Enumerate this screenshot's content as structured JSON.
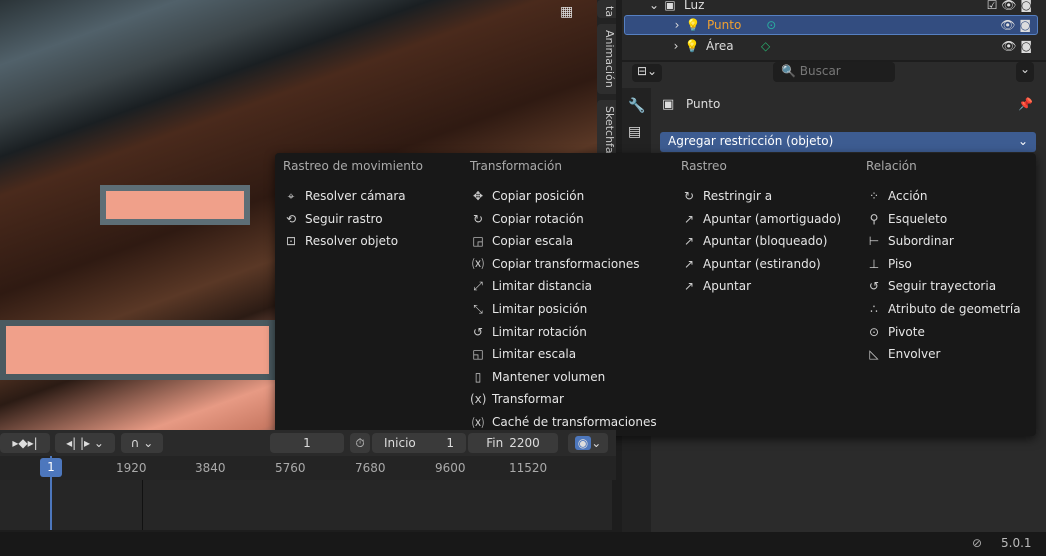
{
  "sidebar_tabs": [
    "ta",
    "Animación",
    "Sketchfa"
  ],
  "outliner": {
    "rows": [
      {
        "label": "Luz"
      },
      {
        "label": "Punto",
        "selected": true
      },
      {
        "label": "Área"
      }
    ]
  },
  "properties": {
    "search_placeholder": "Buscar",
    "object_name": "Punto",
    "add_constraint": "Agregar restricción (objeto)"
  },
  "menu": {
    "columns": [
      {
        "title": "Rastreo de movimiento",
        "items": [
          "Resolver cámara",
          "Seguir rastro",
          "Resolver objeto"
        ]
      },
      {
        "title": "Transformación",
        "items": [
          "Copiar posición",
          "Copiar rotación",
          "Copiar escala",
          "Copiar transformaciones",
          "Limitar distancia",
          "Limitar posición",
          "Limitar rotación",
          "Limitar escala",
          "Mantener volumen",
          "Transformar",
          "Caché de transformaciones"
        ]
      },
      {
        "title": "Rastreo",
        "items": [
          "Restringir a",
          "Apuntar (amortiguado)",
          "Apuntar (bloqueado)",
          "Apuntar (estirando)",
          "Apuntar"
        ]
      },
      {
        "title": "Relación",
        "items": [
          "Acción",
          "Esqueleto",
          "Subordinar",
          "Piso",
          "Seguir trayectoria",
          "Atributo de geometría",
          "Pivote",
          "Envolver"
        ]
      }
    ]
  },
  "timeline": {
    "current_frame": "1",
    "start_label": "Inicio",
    "start": "1",
    "end_label": "Fin",
    "end": "2200",
    "ticks": [
      "1920",
      "3840",
      "5760",
      "7680",
      "9600",
      "11520"
    ],
    "playhead": "1"
  },
  "status": {
    "version": "5.0.1"
  },
  "colors": {
    "accent": "#4d77bd",
    "selected_row": "#334d80",
    "dropdown": "#3d5c91"
  }
}
